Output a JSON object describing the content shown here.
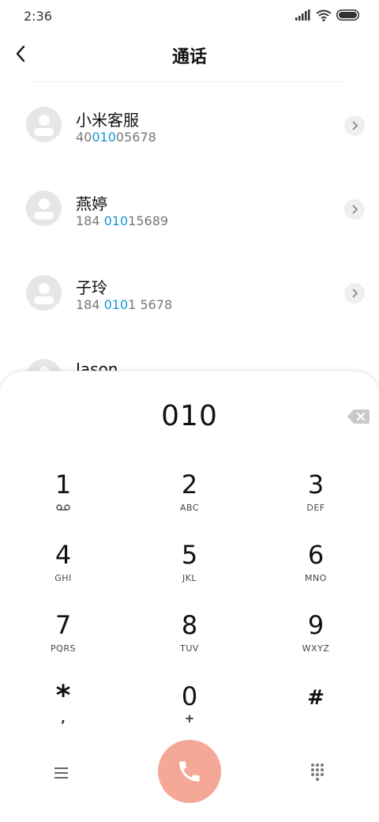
{
  "status_bar": {
    "time": "2:36"
  },
  "header": {
    "title": "通话"
  },
  "contacts": [
    {
      "name": "小米客服",
      "number_pre": "40",
      "number_match": "010",
      "number_post": "05678"
    },
    {
      "name": "燕婷",
      "number_pre": "184 ",
      "number_match": "010",
      "number_post": "15689"
    },
    {
      "name": "子玲",
      "number_pre": "184 ",
      "number_match": "010",
      "number_post": "1 5678"
    },
    {
      "name": "Jason"
    }
  ],
  "dialpad": {
    "number": "010",
    "keys": [
      {
        "digit": "1",
        "letters": ""
      },
      {
        "digit": "2",
        "letters": "ABC"
      },
      {
        "digit": "3",
        "letters": "DEF"
      },
      {
        "digit": "4",
        "letters": "GHI"
      },
      {
        "digit": "5",
        "letters": "JKL"
      },
      {
        "digit": "6",
        "letters": "MNO"
      },
      {
        "digit": "7",
        "letters": "PQRS"
      },
      {
        "digit": "8",
        "letters": "TUV"
      },
      {
        "digit": "9",
        "letters": "WXYZ"
      },
      {
        "digit": "*",
        "letters": ","
      },
      {
        "digit": "0",
        "letters": "+"
      },
      {
        "digit": "#",
        "letters": ""
      }
    ]
  },
  "icons": {
    "back": "chevron-left-icon",
    "detail": "chevron-right-icon",
    "backspace": "backspace-icon",
    "voicemail": "voicemail-icon",
    "menu": "menu-icon",
    "call": "phone-icon",
    "keypad": "keypad-icon"
  },
  "colors": {
    "highlight": "#1896d8",
    "call_button": "#f6a898",
    "avatar": "#e6e6e6"
  }
}
